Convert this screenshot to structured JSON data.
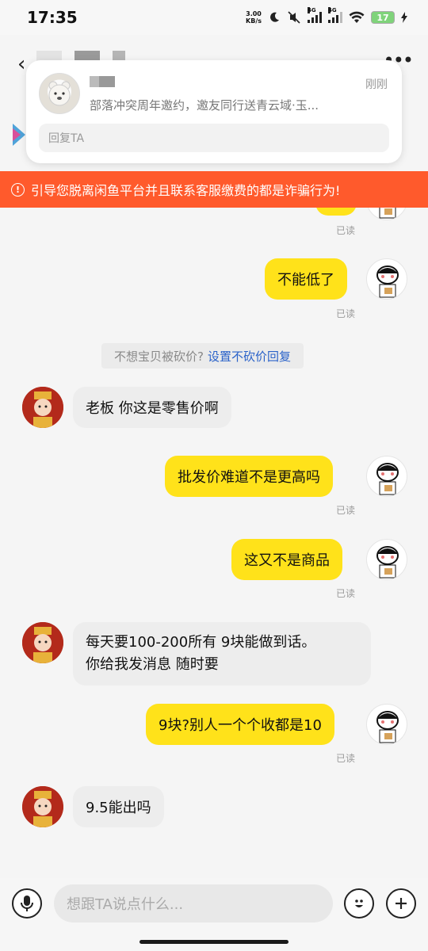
{
  "status_bar": {
    "time": "17:35",
    "net_speed_value": "3.00",
    "net_speed_unit": "KB/s",
    "signal_label_1": "4G",
    "signal_label_2": "4G",
    "battery": "17"
  },
  "notification": {
    "time": "刚刚",
    "text": "部落冲突周年邀约，邀友同行送青云域·玉...",
    "reply_placeholder": "回复TA"
  },
  "warning": {
    "text": "引导您脱离闲鱼平台并且联系客服缴费的都是诈骗行为!",
    "icon": "exclamation-icon"
  },
  "messages": [
    {
      "from": "me",
      "text": "不能低了",
      "read": "已读"
    },
    {
      "from": "them",
      "text": "老板 你这是零售价啊"
    },
    {
      "from": "me",
      "text": "批发价难道不是更高吗",
      "read": "已读"
    },
    {
      "from": "me",
      "text": "这又不是商品",
      "read": "已读"
    },
    {
      "from": "them",
      "line1": "每天要100-200所有 9块能做到话。",
      "line2": "你给我发消息 随时要"
    },
    {
      "from": "me",
      "text": "9块?别人一个个收都是10",
      "read": "已读"
    },
    {
      "from": "them",
      "text": "9.5能出吗"
    }
  ],
  "top_read": "已读",
  "system_tip": {
    "text": "不想宝贝被砍价?",
    "link": "设置不砍价回复"
  },
  "input": {
    "placeholder": "想跟TA说点什么..."
  },
  "colors": {
    "accent_yellow": "#ffe21a",
    "warning_red": "#ff5a2c",
    "link_blue": "#2a62c9"
  }
}
